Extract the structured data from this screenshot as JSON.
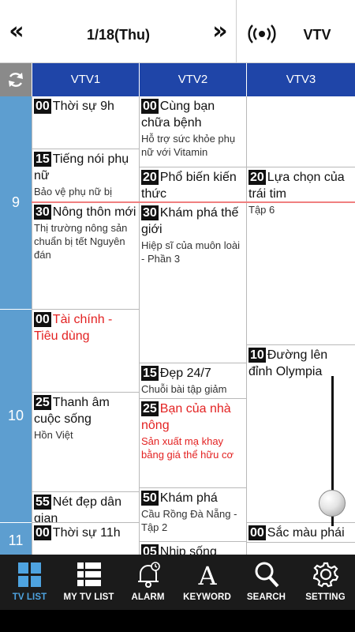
{
  "header": {
    "prev_symbol": "«",
    "next_symbol": "»",
    "date": "1/18(Thu)",
    "channel": "VTV",
    "broadcast_icon": "broadcast-icon"
  },
  "channels": [
    "VTV1",
    "VTV2",
    "VTV3"
  ],
  "hours": [
    "9",
    "10",
    "11"
  ],
  "schedule": {
    "vtv1": [
      {
        "min": "00",
        "title": "Thời sự 9h",
        "desc": ""
      },
      {
        "min": "15",
        "title": "Tiếng nói phụ nữ",
        "desc": "Bảo vệ phụ nữ bị"
      },
      {
        "min": "30",
        "title": "Nông thôn mới",
        "desc": "Thị trường nông sản chuẩn bị tết Nguyên đán"
      },
      {
        "min": "00",
        "title": "Tài chính - Tiêu dùng",
        "desc": ""
      },
      {
        "min": "25",
        "title": "Thanh âm cuộc sống",
        "desc": "Hồn Việt"
      },
      {
        "min": "55",
        "title": "Nét đẹp dân gian",
        "desc": ""
      },
      {
        "min": "00",
        "title": "Thời sự 11h",
        "desc": ""
      }
    ],
    "vtv2": [
      {
        "min": "00",
        "title": "Cùng bạn chữa bệnh",
        "desc": "Hỗ trợ sức khỏe phụ nữ với Vitamin"
      },
      {
        "min": "20",
        "title": "Phổ biến kiến thức",
        "desc": ""
      },
      {
        "min": "30",
        "title": "Khám phá thế giới",
        "desc": "Hiệp sĩ của muôn loài - Phần 3"
      },
      {
        "min": "15",
        "title": "Đẹp 24/7",
        "desc": "Chuỗi bài tập giảm"
      },
      {
        "min": "25",
        "title": "Bạn của nhà nông",
        "desc": "Sản xuất mạ khay bằng giá thể hữu cơ"
      },
      {
        "min": "50",
        "title": "Khám phá",
        "desc": "Cầu Rồng Đà Nẵng - Tập 2"
      },
      {
        "min": "05",
        "title": "Nhịp sống",
        "desc": ""
      }
    ],
    "vtv3": [
      {
        "min": "20",
        "title": "Lựa chọn của trái tim",
        "desc": "Tập 6"
      },
      {
        "min": "10",
        "title": "Đường lên đỉnh Olympia",
        "desc": ""
      },
      {
        "min": "00",
        "title": "Sắc màu phái",
        "desc": ""
      }
    ]
  },
  "bottom_nav": [
    {
      "label": "TV LIST",
      "icon": "grid-icon"
    },
    {
      "label": "MY TV LIST",
      "icon": "list-icon"
    },
    {
      "label": "ALARM",
      "icon": "alarm-bell-icon"
    },
    {
      "label": "KEYWORD",
      "icon": "letter-a-icon"
    },
    {
      "label": "SEARCH",
      "icon": "magnifier-icon"
    },
    {
      "label": "SETTING",
      "icon": "gear-icon"
    }
  ],
  "colors": {
    "channel_header": "#1f45a8",
    "hour_column": "#5d9ed0",
    "highlight_text": "#e32222",
    "now_line": "#f08080",
    "active_nav": "#4ea3e0",
    "nav_bg": "#1b1b1b"
  }
}
